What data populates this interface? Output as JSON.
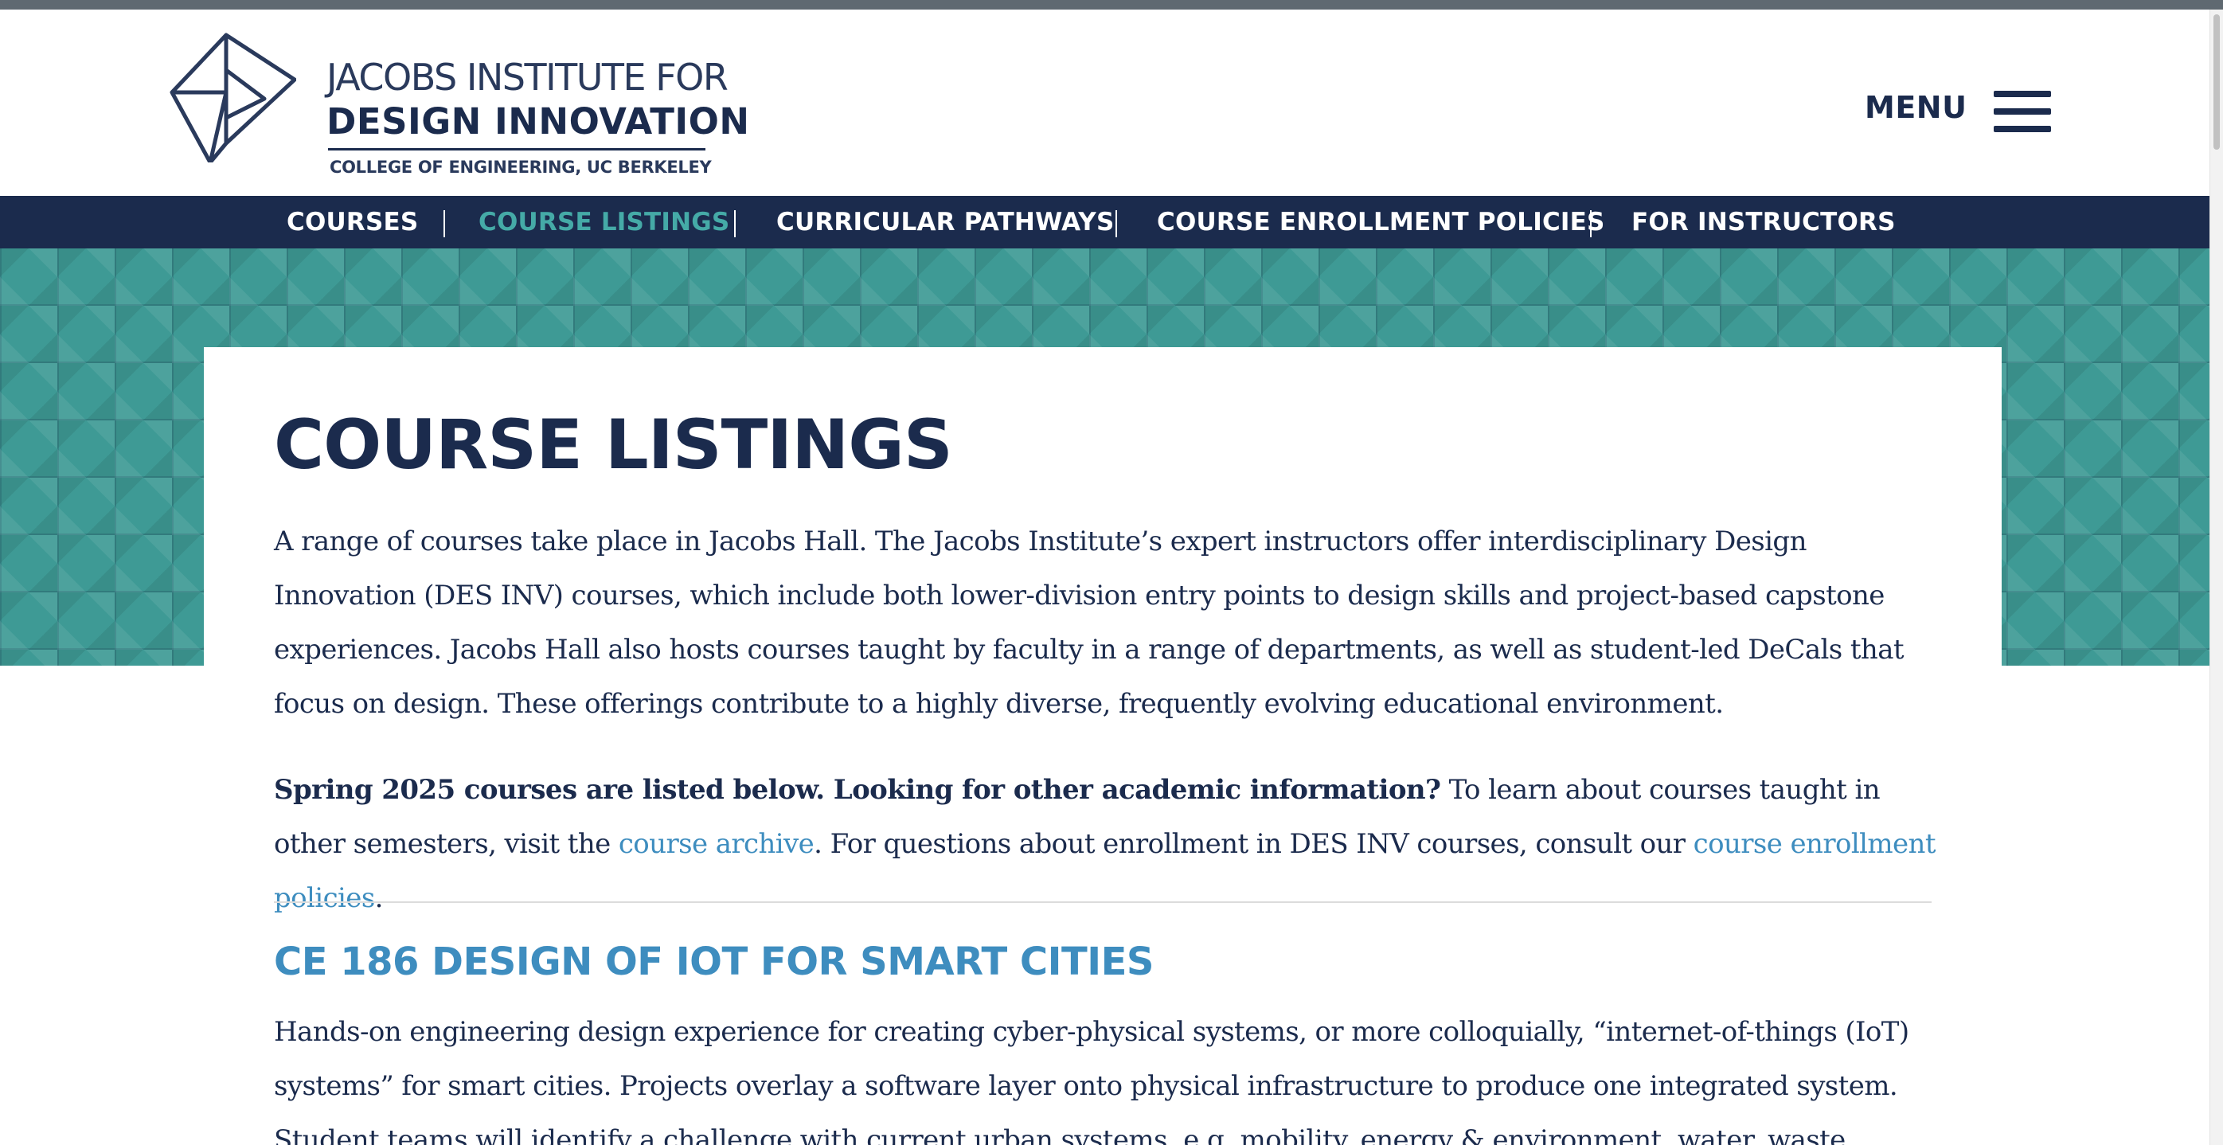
{
  "logo": {
    "line1": "JACOBS INSTITUTE FOR",
    "line2": "DESIGN INNOVATION",
    "line3": "COLLEGE OF ENGINEERING, UC BERKELEY"
  },
  "header": {
    "menu_label": "MENU"
  },
  "nav": {
    "items": [
      {
        "label": "COURSES",
        "active": false
      },
      {
        "label": "COURSE LISTINGS",
        "active": true
      },
      {
        "label": "CURRICULAR PATHWAYS",
        "active": false
      },
      {
        "label": "COURSE ENROLLMENT POLICIES",
        "active": false
      },
      {
        "label": "FOR INSTRUCTORS",
        "active": false
      }
    ]
  },
  "page": {
    "title": "COURSE LISTINGS",
    "intro": "A range of courses take place in Jacobs Hall. The Jacobs Institute’s expert instructors offer interdisciplinary Design Innovation (DES INV) courses, which include both lower-division entry points to design skills and project-based capstone experiences. Jacobs Hall also hosts courses taught by faculty in a range of departments, as well as student-led DeCals that focus on design. These offerings contribute to a highly diverse, frequently evolving educational environment.",
    "spring_bold": "Spring 2025 courses are listed below. Looking for other academic information?",
    "spring_text1": " To learn about courses taught in other semesters, visit the ",
    "archive_link": "course archive",
    "spring_text2": ". For questions about enrollment in DES INV courses, consult our ",
    "policies_link": "course enrollment policies",
    "spring_text3": "."
  },
  "course": {
    "title": "CE 186 DESIGN OF IOT FOR SMART CITIES",
    "description": "Hands-on engineering design experience for creating cyber-physical systems, or more colloquially, “internet-of-things (IoT) systems” for smart cities. Projects overlay a software layer onto physical infrastructure to produce one integrated system. Student teams will identify a challenge with current urban systems, e.g. mobility, energy & environment, water, waste, health, security, and the built"
  },
  "colors": {
    "navy": "#1b2b4d",
    "teal": "#45aaa7",
    "link_blue": "#3e8dbf",
    "hero_teal": "#3e9a95"
  },
  "icons": [
    "logo-mark-icon",
    "hamburger-icon"
  ]
}
